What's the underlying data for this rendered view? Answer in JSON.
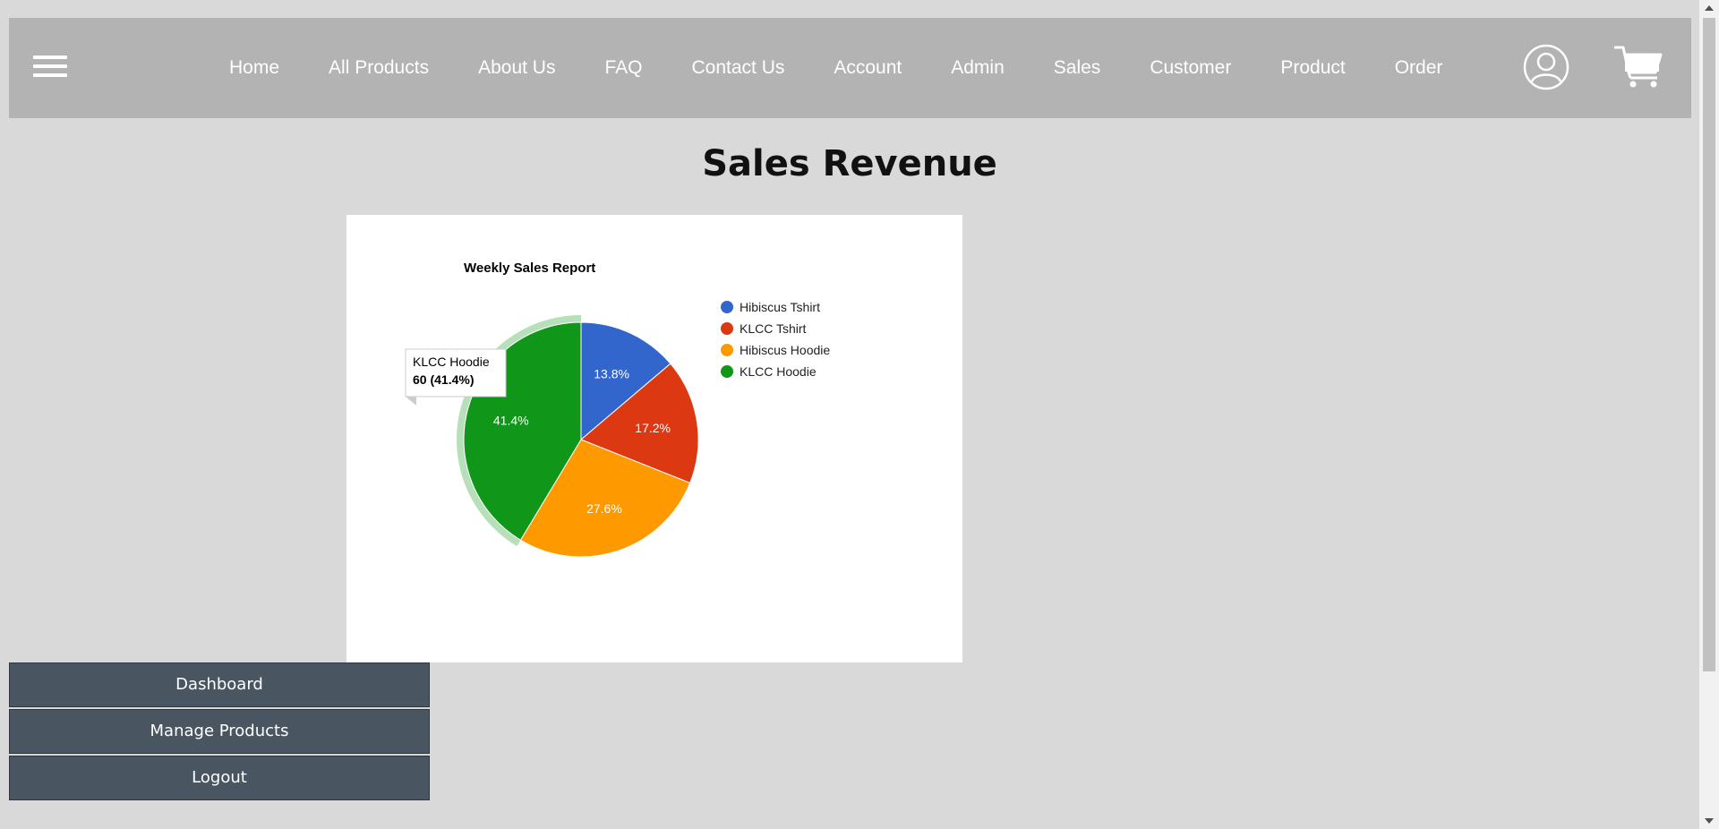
{
  "nav": {
    "menu_icon": "hamburger-icon",
    "links": [
      "Home",
      "All Products",
      "About Us",
      "FAQ",
      "Contact Us",
      "Account",
      "Admin",
      "Sales",
      "Customer",
      "Product",
      "Order"
    ],
    "user_icon": "user-icon",
    "cart_icon": "cart-icon"
  },
  "page": {
    "title": "Sales Revenue"
  },
  "chart_data": {
    "type": "pie",
    "title": "Weekly Sales Report",
    "legend_position": "right",
    "slices": [
      {
        "label": "Hibiscus Tshirt",
        "value": 20,
        "percent_label": "13.8%",
        "color": "#3366cc"
      },
      {
        "label": "KLCC Tshirt",
        "value": 25,
        "percent_label": "17.2%",
        "color": "#dc3912"
      },
      {
        "label": "Hibiscus Hoodie",
        "value": 40,
        "percent_label": "27.6%",
        "color": "#ff9900"
      },
      {
        "label": "KLCC Hoodie",
        "value": 60,
        "percent_label": "41.4%",
        "color": "#109618"
      }
    ],
    "tooltip": {
      "label": "KLCC Hoodie",
      "value_text": "60 (41.4%)"
    }
  },
  "side_menu": {
    "dashboard": "Dashboard",
    "manage_products": "Manage Products",
    "logout": "Logout"
  }
}
